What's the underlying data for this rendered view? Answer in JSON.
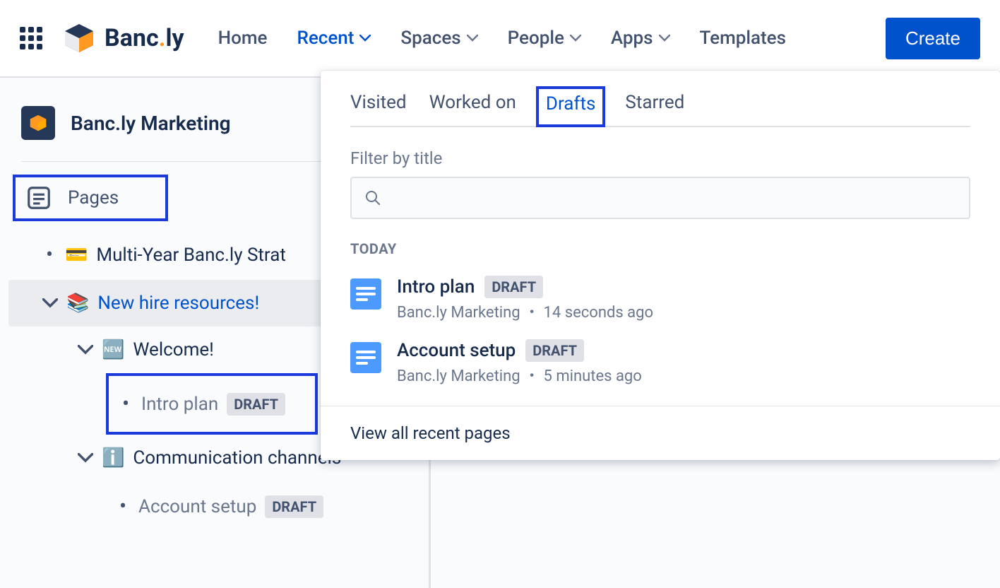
{
  "brand": {
    "name_prefix": "Banc",
    "name_suffix": "ly"
  },
  "nav": {
    "home": "Home",
    "recent": "Recent",
    "spaces": "Spaces",
    "people": "People",
    "apps": "Apps",
    "templates": "Templates",
    "create": "Create"
  },
  "sidebar": {
    "space_name": "Banc.ly Marketing",
    "pages_label": "Pages",
    "tree": {
      "item0": {
        "emoji": "💳",
        "label": "Multi-Year Banc.ly Strat"
      },
      "item1": {
        "emoji": "📚",
        "label": "New hire resources!"
      },
      "item2": {
        "emoji": "🆕",
        "label": "Welcome!"
      },
      "item3": {
        "label": "Intro plan",
        "badge": "DRAFT"
      },
      "item4": {
        "emoji": "ℹ️",
        "label": "Communication channels"
      },
      "item5": {
        "label": "Account setup",
        "badge": "DRAFT"
      }
    }
  },
  "dropdown": {
    "tabs": {
      "visited": "Visited",
      "worked": "Worked on",
      "drafts": "Drafts",
      "starred": "Starred"
    },
    "filter_label": "Filter by title",
    "section_today": "TODAY",
    "rows": [
      {
        "title": "Intro plan",
        "badge": "DRAFT",
        "meta": "Banc.ly Marketing ・ 14 seconds ago"
      },
      {
        "title": "Account setup",
        "badge": "DRAFT",
        "meta": "Banc.ly Marketing ・ 5 minutes ago"
      }
    ],
    "footer": "View all recent pages"
  }
}
